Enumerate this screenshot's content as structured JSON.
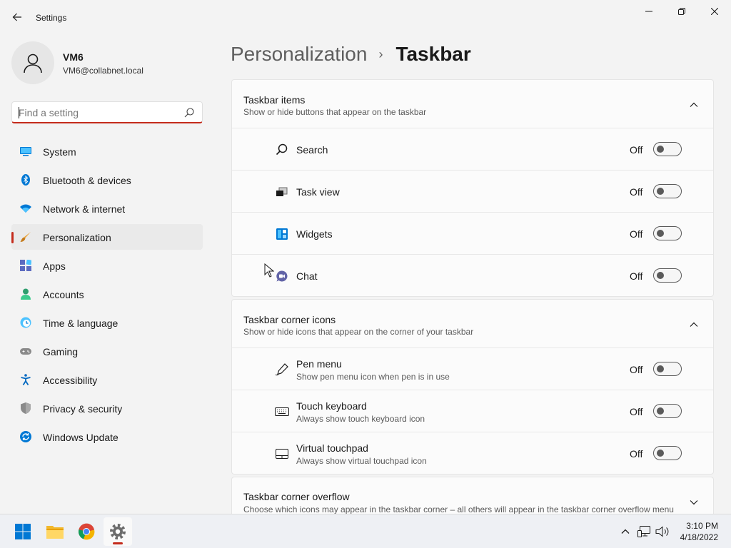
{
  "window": {
    "title": "Settings"
  },
  "profile": {
    "name": "VM6",
    "email": "VM6@collabnet.local"
  },
  "search": {
    "placeholder": "Find a setting",
    "value": ""
  },
  "sidebar": {
    "items": [
      {
        "label": "System",
        "icon": "monitor-icon",
        "color": "#0078d4"
      },
      {
        "label": "Bluetooth & devices",
        "icon": "bluetooth-icon",
        "color": "#0078d4"
      },
      {
        "label": "Network & internet",
        "icon": "wifi-icon",
        "color": "#0078d4"
      },
      {
        "label": "Personalization",
        "icon": "paintbrush-icon",
        "color": "#e8a33a",
        "active": true
      },
      {
        "label": "Apps",
        "icon": "apps-icon",
        "color": "#5c6bc0"
      },
      {
        "label": "Accounts",
        "icon": "person-icon",
        "color": "#2e9e6e"
      },
      {
        "label": "Time & language",
        "icon": "globe-clock-icon",
        "color": "#0078d4"
      },
      {
        "label": "Gaming",
        "icon": "gamepad-icon",
        "color": "#6b6b6b"
      },
      {
        "label": "Accessibility",
        "icon": "accessibility-icon",
        "color": "#0067c0"
      },
      {
        "label": "Privacy & security",
        "icon": "shield-icon",
        "color": "#7a7a7a"
      },
      {
        "label": "Windows Update",
        "icon": "update-icon",
        "color": "#0078d4"
      }
    ]
  },
  "breadcrumb": {
    "parent": "Personalization",
    "separator": "›",
    "current": "Taskbar"
  },
  "sections": [
    {
      "title": "Taskbar items",
      "subtitle": "Show or hide buttons that appear on the taskbar",
      "expanded": true,
      "rows": [
        {
          "label": "Search",
          "desc": "",
          "state": "Off",
          "icon": "search-icon"
        },
        {
          "label": "Task view",
          "desc": "",
          "state": "Off",
          "icon": "task-view-icon"
        },
        {
          "label": "Widgets",
          "desc": "",
          "state": "Off",
          "icon": "widgets-icon"
        },
        {
          "label": "Chat",
          "desc": "",
          "state": "Off",
          "icon": "chat-icon"
        }
      ]
    },
    {
      "title": "Taskbar corner icons",
      "subtitle": "Show or hide icons that appear on the corner of your taskbar",
      "expanded": true,
      "rows": [
        {
          "label": "Pen menu",
          "desc": "Show pen menu icon when pen is in use",
          "state": "Off",
          "icon": "pen-icon"
        },
        {
          "label": "Touch keyboard",
          "desc": "Always show touch keyboard icon",
          "state": "Off",
          "icon": "keyboard-icon"
        },
        {
          "label": "Virtual touchpad",
          "desc": "Always show virtual touchpad icon",
          "state": "Off",
          "icon": "touchpad-icon"
        }
      ]
    },
    {
      "title": "Taskbar corner overflow",
      "subtitle": "Choose which icons may appear in the taskbar corner – all others will appear in the taskbar corner overflow menu",
      "expanded": false,
      "rows": []
    }
  ],
  "taskbar": {
    "apps": [
      {
        "name": "start-icon"
      },
      {
        "name": "file-explorer-icon"
      },
      {
        "name": "chrome-icon"
      },
      {
        "name": "settings-icon",
        "active": true
      }
    ],
    "tray": [
      "chevron-up-icon",
      "network-icon",
      "volume-icon"
    ],
    "time": "3:10 PM",
    "date": "4/18/2022"
  },
  "colors": {
    "accent": "#c42b1c",
    "background": "#f3f3f3",
    "card": "#fbfbfb"
  }
}
